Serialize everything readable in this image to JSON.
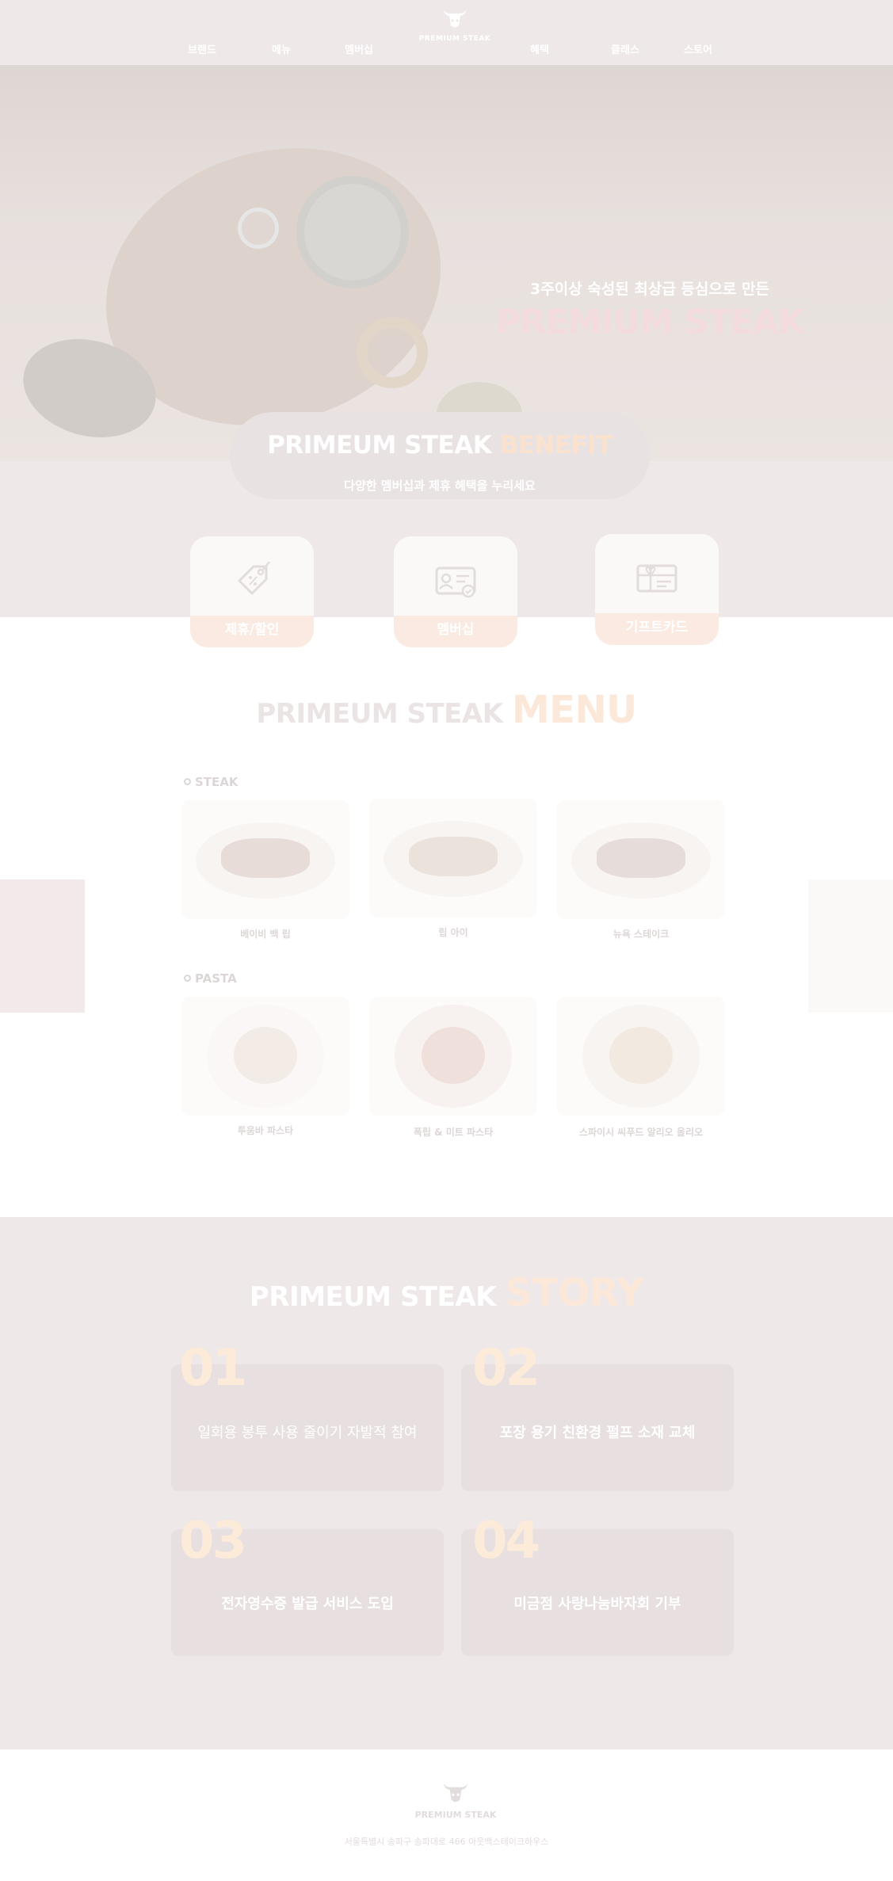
{
  "header": {
    "logo_text": "PREMIUM STEAK",
    "nav_left": [
      "브랜드",
      "메뉴",
      "멤버십"
    ],
    "nav_right": [
      "혜택",
      "클래스",
      "스토어"
    ]
  },
  "hero": {
    "subtitle": "3주이상 숙성된 최상급 등심으로 만든",
    "title": "PREMIUM STEAK"
  },
  "benefit": {
    "title_main": "PRIMEUM STEAK",
    "title_accent": "BENEFIT",
    "subtitle": "다양한 멤버십과 제휴 혜택을 누리세요",
    "cards": [
      {
        "label": "제휴/할인",
        "icon": "tag-icon"
      },
      {
        "label": "멤버십",
        "icon": "member-card-icon"
      },
      {
        "label": "기프트카드",
        "icon": "gift-card-icon"
      }
    ]
  },
  "menu": {
    "title_main": "PRIMEUM STEAK",
    "title_accent": "MENU",
    "categories": [
      {
        "name": "STEAK",
        "items": [
          "베이비 백 립",
          "립 아이",
          "뉴욕 스테이크"
        ]
      },
      {
        "name": "PASTA",
        "items": [
          "투움바 파스타",
          "폭립 & 미트 파스타",
          "스파이시 씨푸드 알리오 올리오"
        ]
      }
    ]
  },
  "story": {
    "title_main": "PRIMEUM STEAK",
    "title_accent": "STORY",
    "items": [
      {
        "num": "01",
        "text": "일회용 봉투 사용 줄이기 자발적 참여"
      },
      {
        "num": "02",
        "text": "포장 용기 친환경 펄프 소재 교체"
      },
      {
        "num": "03",
        "text": "전자영수증 발급 서비스 도입"
      },
      {
        "num": "04",
        "text": "미금점 사랑나눔바자회 기부"
      }
    ]
  },
  "footer": {
    "logo_text": "PREMIUM STEAK",
    "address": "서울특별시 송파구 송파대로 466 아웃백스테이크하우스"
  },
  "colors": {
    "header_bg": "#efe8e8",
    "accent_peach": "#fbe2cf",
    "title_pink": "#f4dcdc",
    "story_bg": "#efe8e8"
  }
}
